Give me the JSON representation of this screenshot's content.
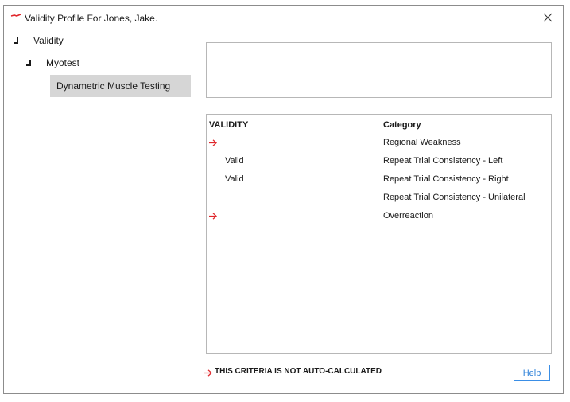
{
  "window": {
    "title": "Validity Profile For Jones, Jake.",
    "icon": "app-logo-icon",
    "close_icon": "close-icon"
  },
  "tree": {
    "items": [
      {
        "label": "Validity",
        "expanded": true
      },
      {
        "label": "Myotest",
        "expanded": true
      },
      {
        "label": "Dynametric Muscle Testing",
        "selected": true
      }
    ]
  },
  "grid": {
    "headers": {
      "validity": "VALIDITY",
      "category": "Category"
    },
    "rows": [
      {
        "validity": "",
        "flag": true,
        "category": "Regional Weakness"
      },
      {
        "validity": "Valid",
        "flag": false,
        "category": "Repeat Trial Consistency - Left"
      },
      {
        "validity": "Valid",
        "flag": false,
        "category": "Repeat Trial Consistency - Right"
      },
      {
        "validity": "",
        "flag": false,
        "category": "Repeat Trial Consistency - Unilateral"
      },
      {
        "validity": "",
        "flag": true,
        "category": "Overreaction"
      }
    ]
  },
  "footer": {
    "note": "THIS CRITERIA IS NOT AUTO-CALCULATED",
    "help_label": "Help"
  },
  "colors": {
    "flag_arrow": "#e0262b",
    "help_accent": "#2b7fd8",
    "selected_row": "#d6d6d6"
  }
}
